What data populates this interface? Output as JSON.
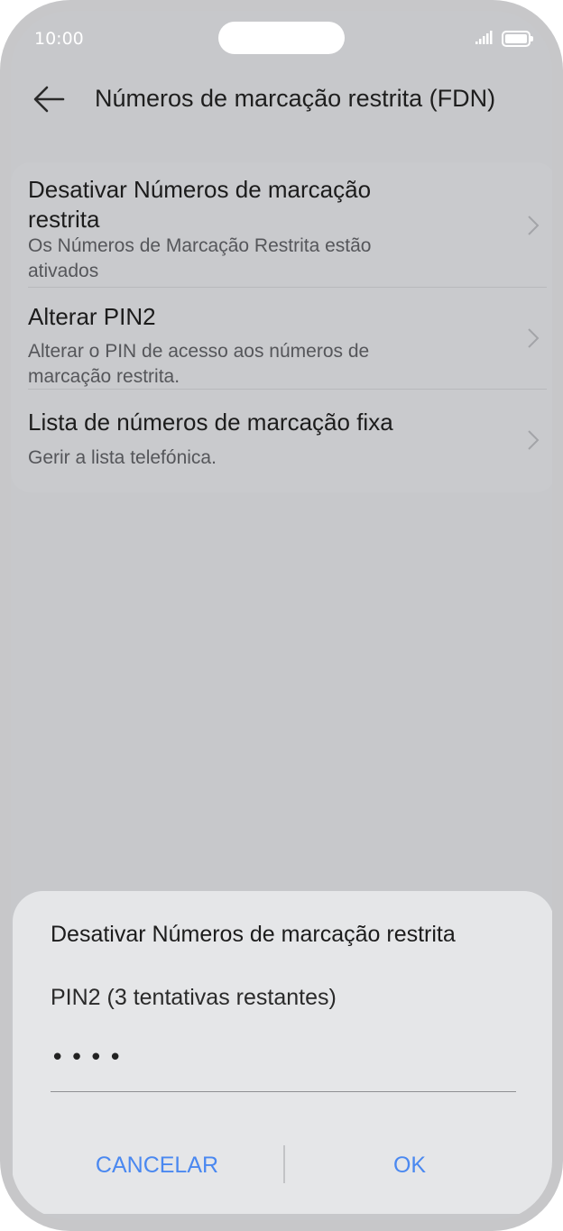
{
  "status_bar": {
    "time": "10:00"
  },
  "header": {
    "title": "Números de marcação restrita (FDN)"
  },
  "settings_items": [
    {
      "title_line1": "Desativar Números de marcação",
      "title_line2": "restrita",
      "subtitle_line1": "Os Números de Marcação Restrita estão",
      "subtitle_line2": "ativados"
    },
    {
      "title_line1": "Alterar PIN2",
      "subtitle_line1": "Alterar o PIN de acesso aos números de",
      "subtitle_line2": "marcação restrita."
    },
    {
      "title_line1": "Lista de números de marcação fixa",
      "subtitle_line1": "Gerir a lista telefónica."
    }
  ],
  "dialog": {
    "title": "Desativar Números de marcação restrita",
    "pin_label": "PIN2 (3 tentativas restantes)",
    "pin_value_masked": "••••",
    "cancel_label": "CANCELAR",
    "ok_label": "OK"
  },
  "colors": {
    "accent": "#4a88f0",
    "background": "#c7c8cb",
    "dialog_bg": "#e5e6e8"
  },
  "icons": {
    "back": "arrow-left-icon",
    "chevron": "chevron-right-icon",
    "signal": "signal-icon",
    "battery": "battery-icon"
  }
}
